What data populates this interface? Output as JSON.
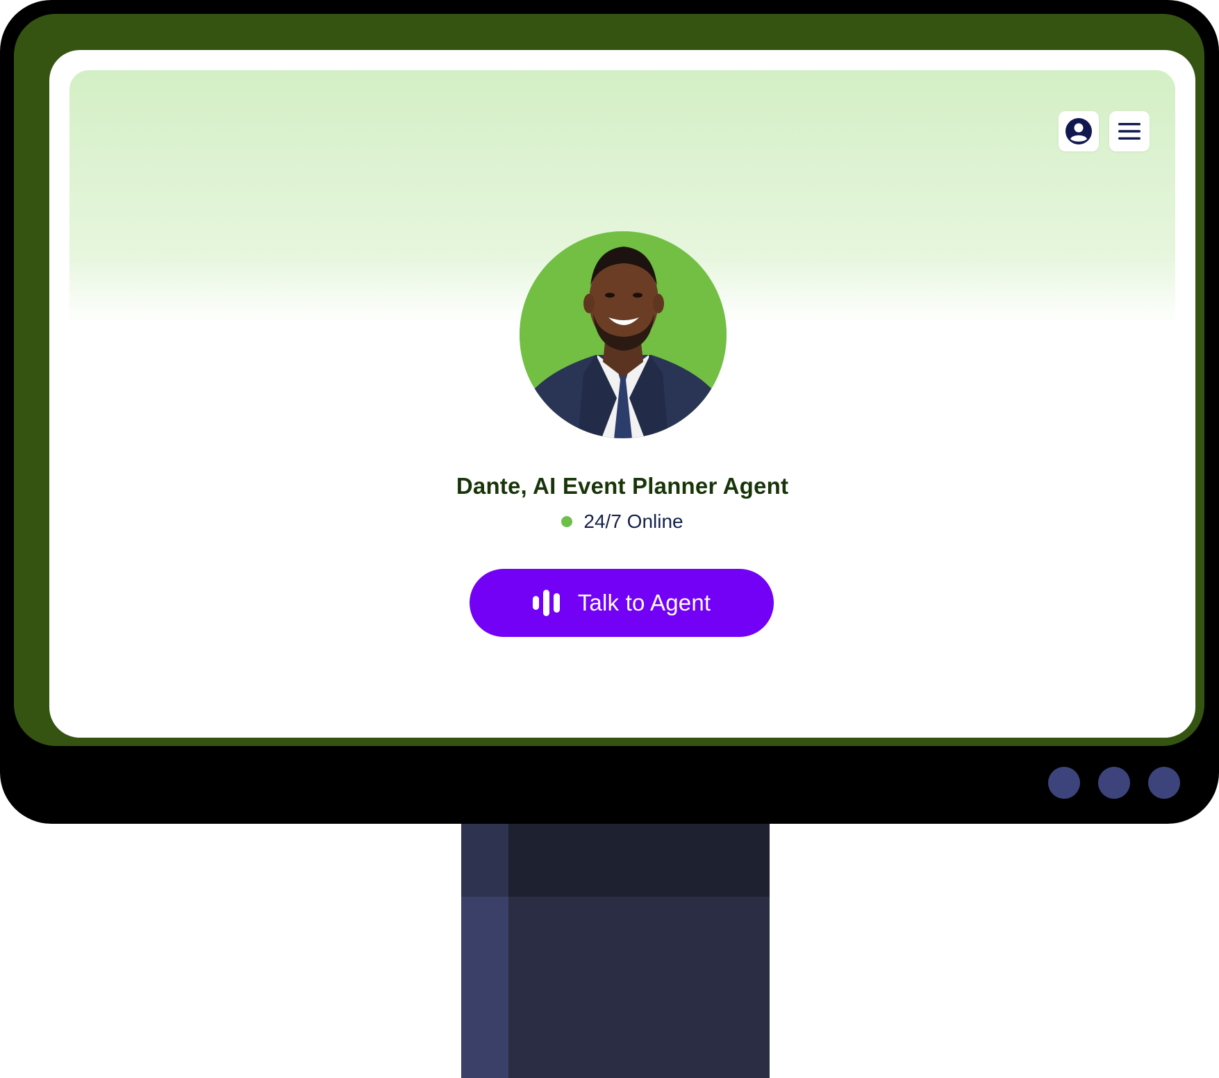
{
  "agent": {
    "name": "Dante, AI Event Planner Agent",
    "status": "24/7 Online",
    "status_color": "#6cc04a"
  },
  "actions": {
    "talk_label": "Talk to Agent",
    "talk_icon": "audio-bars-icon",
    "button_color": "#7201f5"
  },
  "header": {
    "profile_icon": "user-profile-icon",
    "menu_icon": "hamburger-menu-icon"
  },
  "theme": {
    "bezel_color": "#355412",
    "avatar_bg": "#72bf44",
    "name_color": "#183509"
  }
}
